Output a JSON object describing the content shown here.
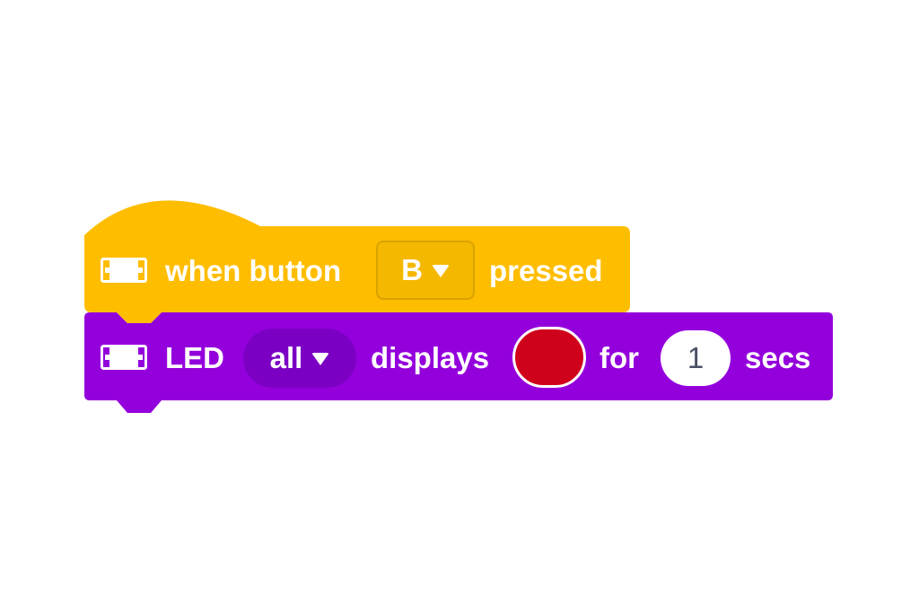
{
  "hat_block": {
    "color": "#ffbd00",
    "label_prefix": "when button",
    "button_selected": "B",
    "label_suffix": "pressed",
    "icon": "device-icon"
  },
  "led_block": {
    "color": "#9400dc",
    "label_led": "LED",
    "target_selected": "all",
    "label_displays": "displays",
    "color_value": "#d0021b",
    "label_for": "for",
    "duration": "1",
    "label_secs": "secs",
    "icon": "device-icon"
  }
}
